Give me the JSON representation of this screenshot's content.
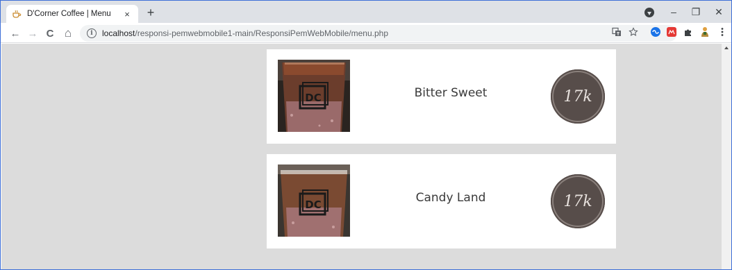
{
  "browser": {
    "tab_title": "D'Corner Coffee | Menu",
    "tab_close": "×",
    "new_tab": "+",
    "url_host": "localhost",
    "url_path": "/responsi-pemwebmobile1-main/ResponsiPemWebMobile/menu.php",
    "window_controls": {
      "minimize": "–",
      "restore": "❐",
      "close": "✕"
    },
    "nav": {
      "back": "←",
      "forward": "→",
      "reload": "C",
      "home": "⌂"
    },
    "icons": [
      "translate-icon",
      "star-icon",
      "extension-icon",
      "puzzle-icon",
      "profile-icon",
      "menu-icon"
    ]
  },
  "menu": {
    "items": [
      {
        "name": "Bitter Sweet",
        "price": "17k",
        "logo": "DC"
      },
      {
        "name": "Candy Land",
        "price": "17k",
        "logo": "DC"
      }
    ]
  },
  "colors": {
    "page_bg": "#dcdcdc",
    "card_bg": "#ffffff",
    "price_badge": "#574d4a",
    "window_border": "#3d6fd8"
  }
}
